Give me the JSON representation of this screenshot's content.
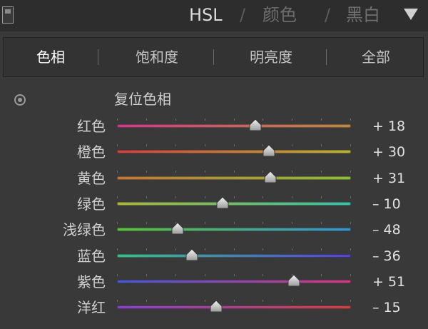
{
  "header": {
    "tabs": [
      {
        "label": "HSL",
        "active": true
      },
      {
        "label": "颜色",
        "active": false
      },
      {
        "label": "黑白",
        "active": false
      }
    ],
    "separator": "/"
  },
  "subtabs": [
    {
      "label": "色相",
      "active": true
    },
    {
      "label": "饱和度",
      "active": false
    },
    {
      "label": "明亮度",
      "active": false
    },
    {
      "label": "全部",
      "active": false
    }
  ],
  "reset_label": "复位色相",
  "sliders": [
    {
      "label": "红色",
      "value": 18,
      "display": "+ 18",
      "colors": [
        "#c63f86",
        "#b98a45"
      ]
    },
    {
      "label": "橙色",
      "value": 30,
      "display": "+ 30",
      "colors": [
        "#c84545",
        "#b6b23a"
      ]
    },
    {
      "label": "黄色",
      "value": 31,
      "display": "+ 31",
      "colors": [
        "#c0783e",
        "#8ebd3e"
      ]
    },
    {
      "label": "绿色",
      "value": -10,
      "display": "– 10",
      "colors": [
        "#a9b63e",
        "#3ebda4"
      ]
    },
    {
      "label": "浅绿色",
      "value": -48,
      "display": "– 48",
      "colors": [
        "#5fbd40",
        "#3c8fc8"
      ]
    },
    {
      "label": "蓝色",
      "value": -36,
      "display": "– 36",
      "colors": [
        "#3fbd8a",
        "#5845c4"
      ]
    },
    {
      "label": "紫色",
      "value": 51,
      "display": "+ 51",
      "colors": [
        "#4a5ac6",
        "#c4407c"
      ]
    },
    {
      "label": "洋红",
      "value": -15,
      "display": "– 15",
      "colors": [
        "#8445c4",
        "#c44646"
      ]
    }
  ],
  "slider_range": [
    -100,
    100
  ]
}
